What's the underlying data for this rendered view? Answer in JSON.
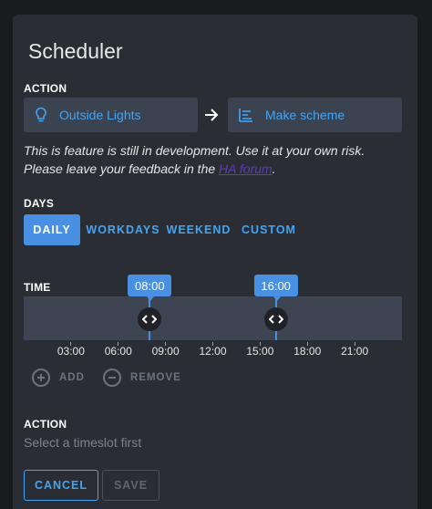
{
  "card": {
    "title": "Scheduler"
  },
  "action_section": {
    "label": "ACTION",
    "entity": {
      "label": "Outside Lights",
      "icon": "lightbulb-icon"
    },
    "arrow_icon": "arrow-right-icon",
    "target": {
      "label": "Make scheme",
      "icon": "scheme-list-icon"
    }
  },
  "notice": {
    "before": "This is feature is still in development. Use it at your own risk. Please leave your feedback in the ",
    "link": "HA forum",
    "after": "."
  },
  "days": {
    "label": "DAYS",
    "options": [
      {
        "label": "DAILY",
        "active": true
      },
      {
        "label": "WORKDAYS",
        "active": false
      },
      {
        "label": "WEEKEND",
        "active": false
      },
      {
        "label": "CUSTOM",
        "active": false
      }
    ]
  },
  "time": {
    "label": "TIME",
    "handles": [
      {
        "label": "08:00",
        "hours": 8
      },
      {
        "label": "16:00",
        "hours": 16
      }
    ],
    "ticks": [
      "03:00",
      "06:00",
      "09:00",
      "12:00",
      "15:00",
      "18:00",
      "21:00"
    ]
  },
  "slot_actions": {
    "add_label": "ADD",
    "remove_label": "REMOVE"
  },
  "action2": {
    "label": "ACTION",
    "hint": "Select a timeslot first"
  },
  "footer": {
    "cancel_label": "CANCEL",
    "save_label": "SAVE"
  },
  "colors": {
    "accent": "#42a5f5",
    "active_tab": "#4a90e2",
    "card_bg": "#2a2d33",
    "track_bg": "#3d4452"
  }
}
